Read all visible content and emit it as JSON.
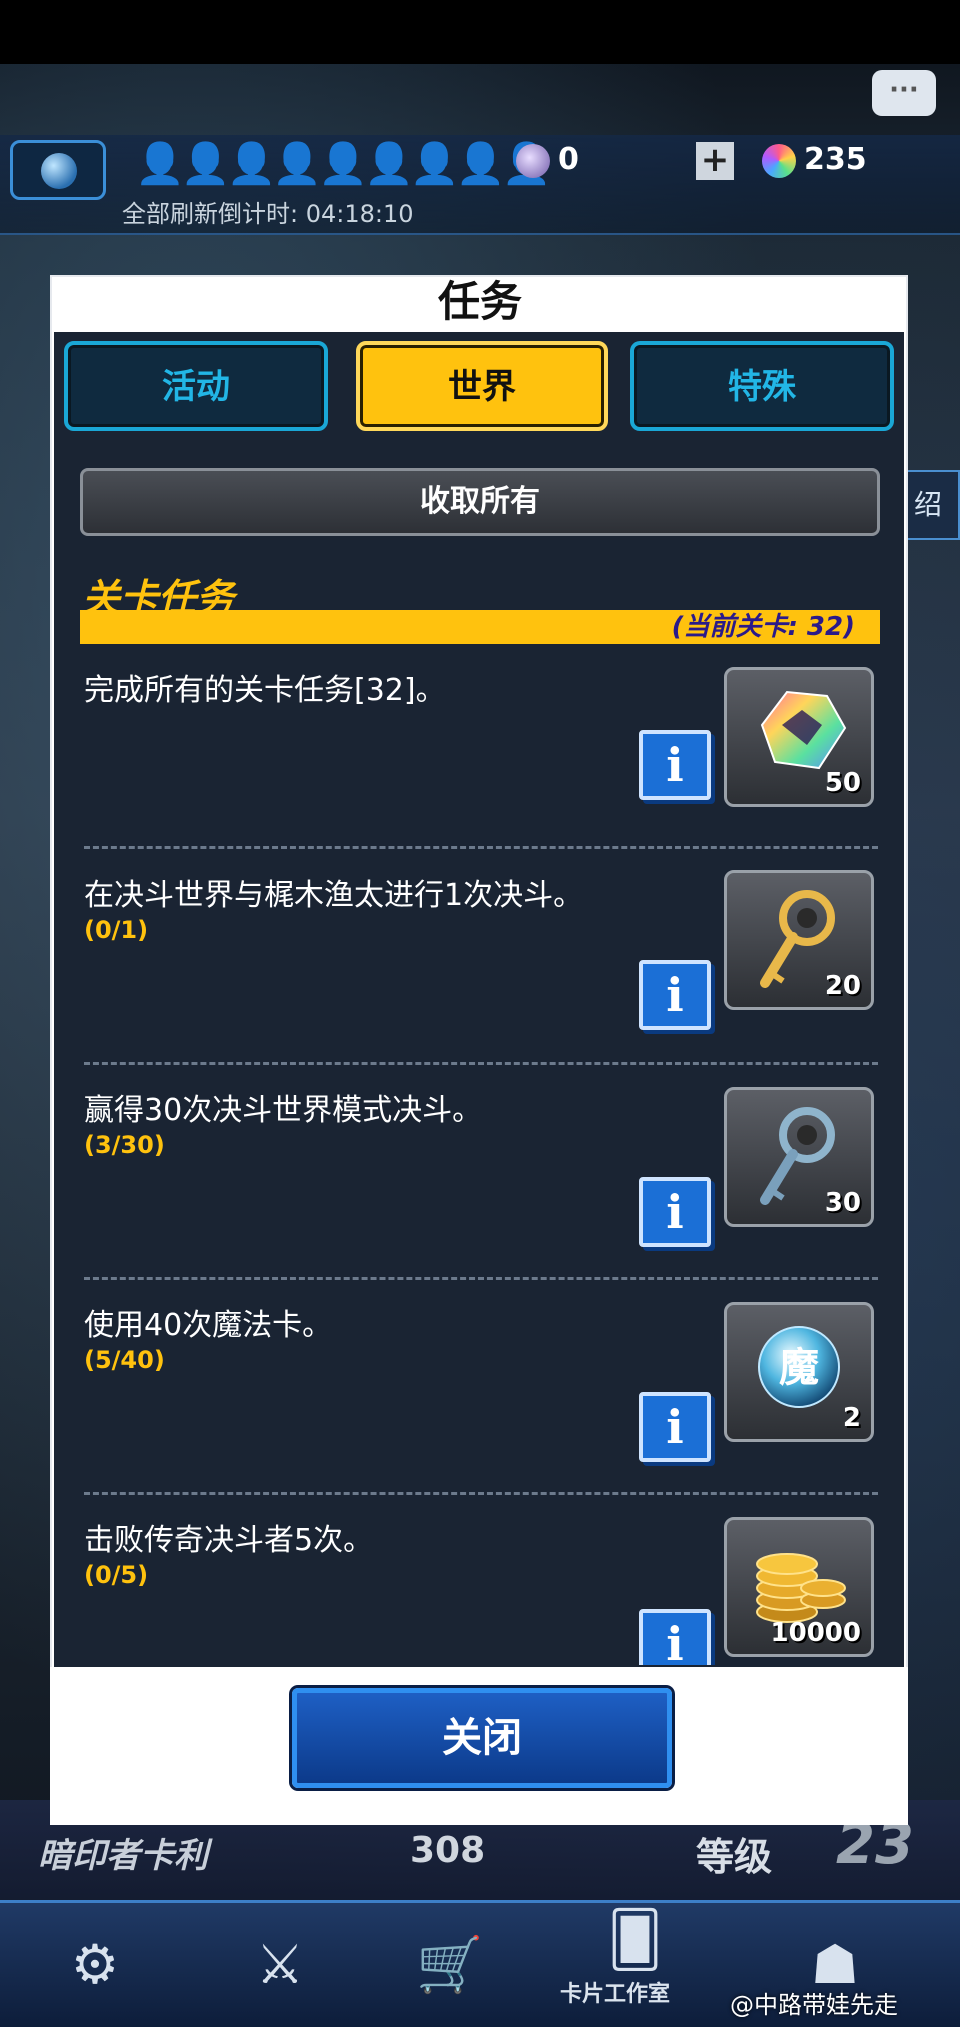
{
  "header": {
    "people_icons": "👤👤👤👤👤👤👤👤👤",
    "timer": "全部刷新倒计时: 04:18:10",
    "currency": [
      {
        "name": "orb",
        "value": "0",
        "color": "#b6a0d8"
      },
      {
        "name": "gem",
        "value": "235",
        "color": "#6fdc8a"
      }
    ],
    "plus_label": "+",
    "chat_label": "···"
  },
  "side_deco": "绍",
  "modal": {
    "title": "任务",
    "tabs": [
      {
        "label": "活动",
        "active": false
      },
      {
        "label": "世界",
        "active": true
      },
      {
        "label": "特殊",
        "active": false
      }
    ],
    "collect_all": "收取所有",
    "section_title": "关卡任务",
    "current_stage": "(当前关卡: 32)",
    "info_label": "i",
    "missions": [
      {
        "text": "完成所有的关卡任务[32]。",
        "progress": "",
        "reward_icon": "rainbow-gem-icon",
        "reward_count": "50"
      },
      {
        "text": "在决斗世界与梶木渔太进行1次决斗。",
        "progress": "(0/1)",
        "reward_icon": "gold-key-icon",
        "reward_count": "20"
      },
      {
        "text": "赢得30次决斗世界模式决斗。",
        "progress": "(3/30)",
        "reward_icon": "silver-key-icon",
        "reward_count": "30"
      },
      {
        "text": "使用40次魔法卡。",
        "progress": "(5/40)",
        "reward_icon": "magic-orb-icon",
        "reward_count": "2"
      },
      {
        "text": "击败传奇决斗者5次。",
        "progress": "(0/5)",
        "reward_icon": "gold-coins-icon",
        "reward_count": "10000"
      }
    ],
    "close": "关闭"
  },
  "bottom": {
    "duelist_name": "暗印者卡利",
    "duelist_value": "308",
    "rank_label": "等级",
    "rank_value": "23",
    "nav": [
      {
        "icon": "⚙",
        "name": "duelist-icon"
      },
      {
        "icon": "⚔",
        "name": "swords-icon"
      },
      {
        "icon": "🛒",
        "name": "cart-icon"
      },
      {
        "icon": "🂠",
        "name": "cards-icon"
      },
      {
        "icon": "☗",
        "name": "mask-icon"
      }
    ],
    "card_workshop": "卡片工作室"
  },
  "watermark": "@中路带娃先走"
}
